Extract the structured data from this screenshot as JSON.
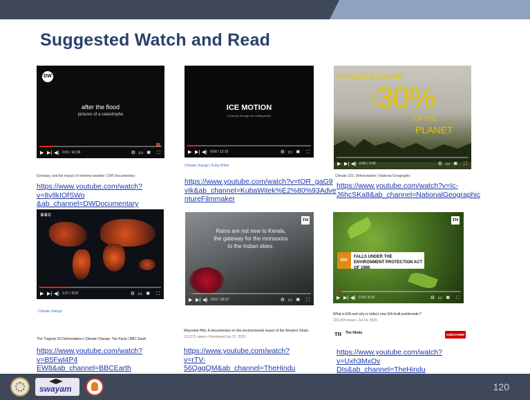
{
  "slide": {
    "title": "Suggested Watch and Read",
    "page_number": "120"
  },
  "cards": [
    {
      "thumb_title": "after the flood",
      "thumb_subtitle": "pictures of a catastrophe",
      "logo": "DW",
      "time": "0:01 / 42:26",
      "progress": 0.12,
      "desc_line": "Germany and the impact of extreme weather | DW Documentary",
      "link_lines": [
        "https://www.youtube.com/watch?v=8yIlkIOfSWo",
        "&ab_channel=DWDocumentary"
      ]
    },
    {
      "thumb_title": "ICE MOTION",
      "thumb_subtitle": "A journey through the melting Arctic",
      "time": "0:00 / 12:15",
      "progress": 0.08,
      "desc_line": "Climate change | Kuba Witek",
      "link_lines": [
        "https://www.youtube.com/watch?v=tOR_gaG9",
        "vIk&ab_channel=KubaWitek%E2%80%93Adve",
        "ntureFilmmaker"
      ]
    },
    {
      "thumb_title": "30%",
      "forest_line1": "FORESTS COVER",
      "forest_about": "ABOUT",
      "forest_line2": "OF THE",
      "forest_line3": "PLANET",
      "time": "0:00 / 2:40",
      "progress": 0.0,
      "desc_line": "Climate 101: Deforestation | National Geographic",
      "link_lines": [
        "https://www.youtube.com/watch?v=Ic-",
        "J6hcSKa8&ab_channel=NationalGeographic"
      ]
    },
    {
      "logo": "BBC",
      "time": "1:57 / 8:07",
      "progress": 0.22,
      "channel": "Climate change",
      "desc_line": "The Tragedy Of Deforestation | Climate Change: The Facts | BBC Earth",
      "link_lines": [
        "https://www.youtube.com/watch?v=B5Fwl4P4",
        "EW8&ab_channel=BBCEarth"
      ]
    },
    {
      "thumb_text": "Rains are not new to Kerala, the gateway for the monsoons to the Indian skies.",
      "logo": "TH",
      "time": "0:01 / 26:07",
      "progress": 0.04,
      "desc_line": "Wounded Hills: A documentary on the environmental issues of the Western Ghats",
      "meta_line": "113,271 views • Premiered Jun 17, 2020",
      "link_lines": [
        "https://www.youtube.com/watch?v=rTV-",
        "56QagQM&ab_channel=TheHindu"
      ]
    },
    {
      "badge": "EIA",
      "banner_text": "FALLS UNDER THE ENVIRONMENT PROTECTION ACT OF 1986",
      "logo": "TH",
      "time": "0:18 / 8:31",
      "progress": 0.05,
      "desc_line": "What is EIA and why is India's new EIA draft problematic?",
      "meta_line": "223,294 views • Jul 14, 2020",
      "channel": "The Hindu",
      "subscribe": "SUBSCRIBE",
      "link_lines": [
        "https://www.youtube.com/watch?v=Uxh3MxOv",
        "DIs&ab_channel=TheHindu"
      ]
    }
  ],
  "colors": {
    "band": "#3e4858",
    "accent": "#8fa2bf",
    "title": "#2a3f6c",
    "link": "#1a35a8",
    "progress": "#e62117"
  },
  "icons": [
    "play-icon",
    "next-icon",
    "volume-icon",
    "settings-icon",
    "subtitles-icon",
    "fullscreen-icon"
  ],
  "footer": {
    "logo2_text": "swayam"
  }
}
